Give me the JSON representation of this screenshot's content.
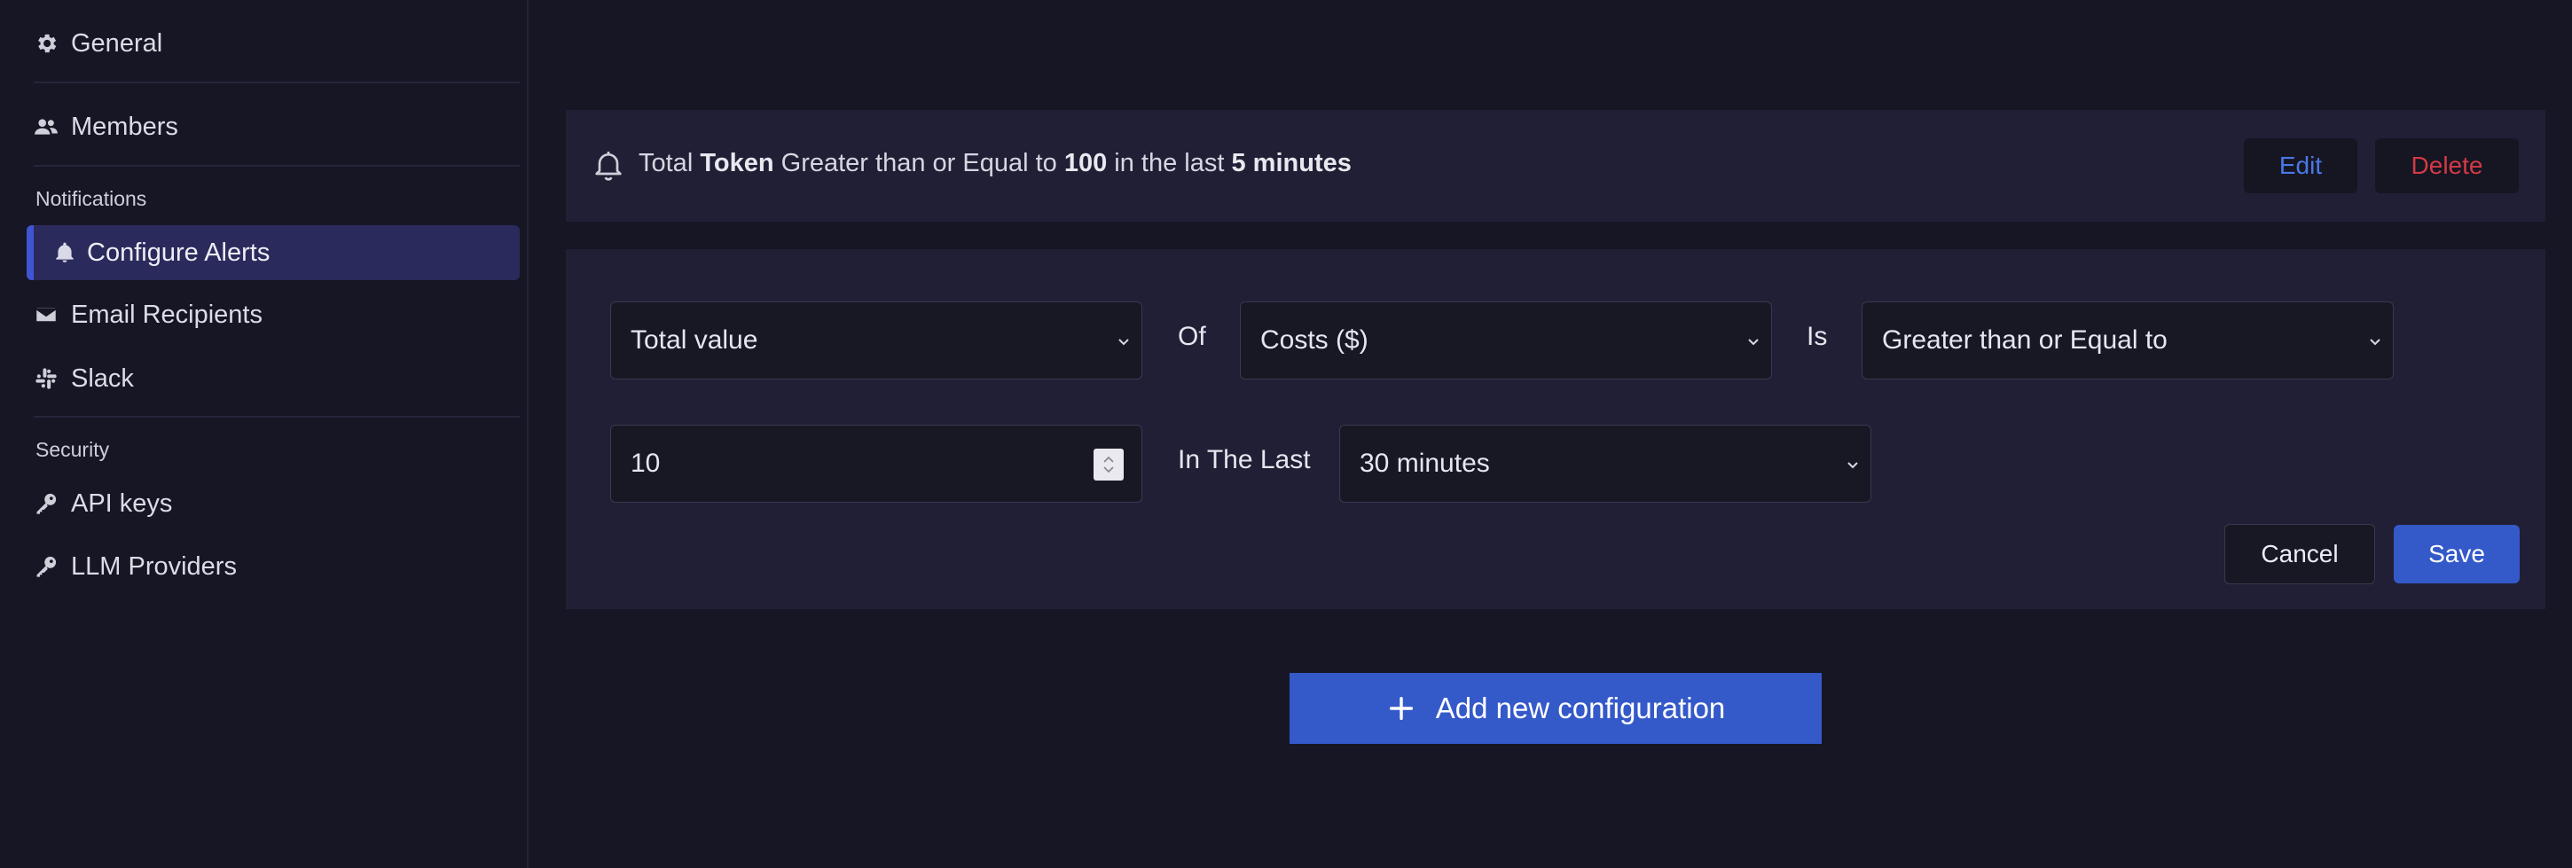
{
  "sidebar": {
    "general": "General",
    "members": "Members",
    "notifications_heading": "Notifications",
    "configure_alerts": "Configure Alerts",
    "email_recipients": "Email Recipients",
    "slack": "Slack",
    "security_heading": "Security",
    "api_keys": "API keys",
    "llm_providers": "LLM Providers"
  },
  "alert": {
    "prefix": "Total",
    "metric": "Token",
    "condition": "Greater than or Equal to",
    "threshold": "100",
    "window_prefix": "in the last",
    "window": "5 minutes",
    "edit_label": "Edit",
    "delete_label": "Delete"
  },
  "config": {
    "aggregation": "Total value",
    "of_label": "Of",
    "metric": "Costs ($)",
    "is_label": "Is",
    "operator": "Greater than or Equal to",
    "threshold_value": "10",
    "in_the_last_label": "In The Last",
    "window": "30 minutes",
    "cancel_label": "Cancel",
    "save_label": "Save"
  },
  "add_button_label": "Add new configuration",
  "colors": {
    "background": "#171625",
    "panel": "#201f35",
    "accent": "#3459c9",
    "edit": "#4a78e8",
    "delete": "#d33a45"
  }
}
